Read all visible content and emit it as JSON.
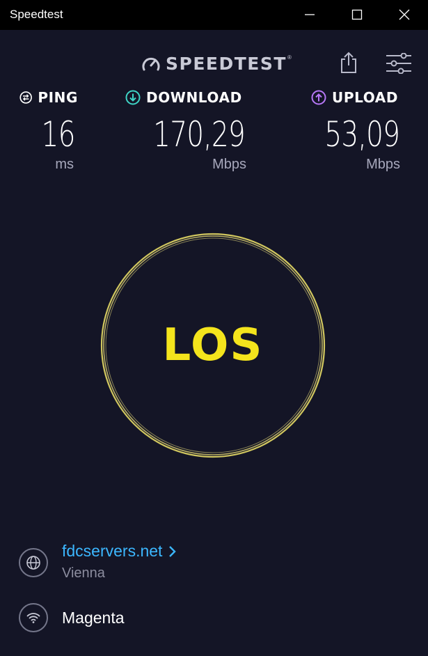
{
  "window": {
    "title": "Speedtest"
  },
  "logo": {
    "text": "SPEEDTEST",
    "trademark": "®"
  },
  "metrics": {
    "ping": {
      "label": "PING",
      "value": "16",
      "unit": "ms",
      "icon_color": "#ffffff"
    },
    "download": {
      "label": "DOWNLOAD",
      "value": "170,29",
      "unit": "Mbps",
      "icon_color": "#3fd5c6"
    },
    "upload": {
      "label": "UPLOAD",
      "value": "53,09",
      "unit": "Mbps",
      "icon_color": "#b778f7"
    }
  },
  "go_button": {
    "label": "LOS",
    "color": "#f4e41c"
  },
  "server": {
    "name": "fdcservers.net",
    "location": "Vienna"
  },
  "provider": {
    "name": "Magenta"
  },
  "colors": {
    "background": "#141526",
    "link": "#3cb7ff",
    "muted": "#8c8d9f"
  }
}
